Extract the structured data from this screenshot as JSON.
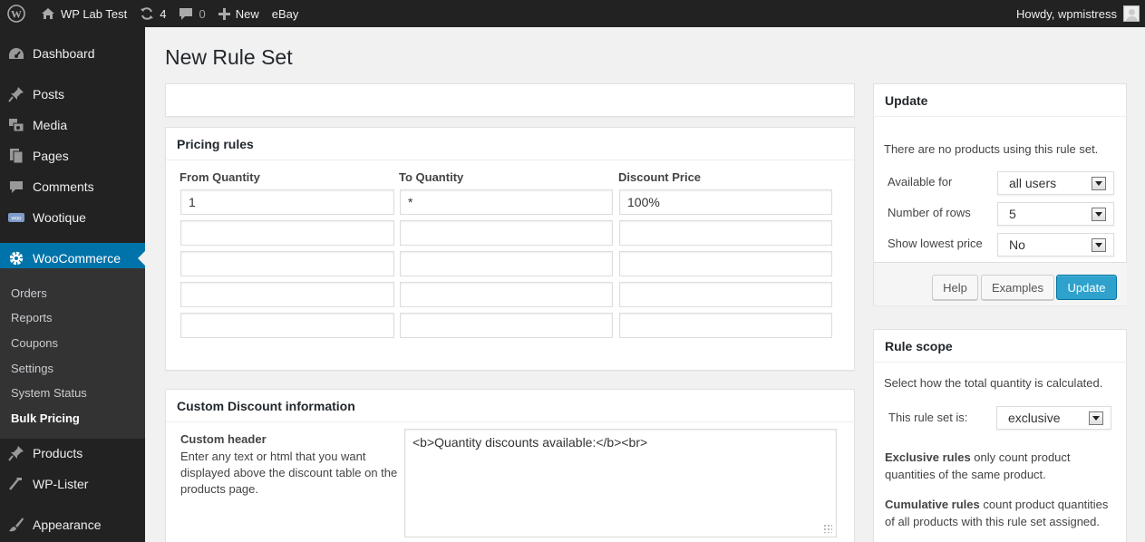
{
  "adminbar": {
    "site_name": "WP Lab Test",
    "updates_count": "4",
    "comments_count": "0",
    "new_label": "New",
    "ebay_label": "eBay",
    "howdy": "Howdy, wpmistress"
  },
  "sidebar": {
    "items": [
      {
        "label": "Dashboard",
        "icon": "dashboard-icon"
      },
      {
        "label": "Posts",
        "icon": "pin-icon"
      },
      {
        "label": "Media",
        "icon": "media-icon"
      },
      {
        "label": "Pages",
        "icon": "pages-icon"
      },
      {
        "label": "Comments",
        "icon": "comment-icon"
      },
      {
        "label": "Wootique",
        "icon": "woo-icon"
      },
      {
        "label": "WooCommerce",
        "icon": "gear-icon"
      },
      {
        "label": "Products",
        "icon": "pin-icon"
      },
      {
        "label": "WP-Lister",
        "icon": "hammer-icon"
      },
      {
        "label": "Appearance",
        "icon": "brush-icon"
      }
    ],
    "submenu": [
      "Orders",
      "Reports",
      "Coupons",
      "Settings",
      "System Status",
      "Bulk Pricing"
    ]
  },
  "page": {
    "title": "New Rule Set"
  },
  "pricing": {
    "title": "Pricing rules",
    "columns": [
      "From Quantity",
      "To Quantity",
      "Discount Price"
    ],
    "rows": [
      [
        "1",
        "*",
        "100%"
      ],
      [
        "",
        "",
        ""
      ],
      [
        "",
        "",
        ""
      ],
      [
        "",
        "",
        ""
      ],
      [
        "",
        "",
        ""
      ]
    ]
  },
  "custom": {
    "title": "Custom Discount information",
    "header_label": "Custom header",
    "header_desc": "Enter any text or html that you want displayed above the discount table on the products page.",
    "header_value": "<b>Quantity discounts available:</b><br>"
  },
  "update": {
    "title": "Update",
    "notice": "There are no products using this rule set.",
    "available_label": "Available for",
    "available_value": "all users",
    "rows_label": "Number of rows",
    "rows_value": "5",
    "lowest_label": "Show lowest price",
    "lowest_value": "No",
    "help_label": "Help",
    "examples_label": "Examples",
    "update_label": "Update"
  },
  "scope": {
    "title": "Rule scope",
    "intro": "Select how the total quantity is calculated.",
    "rule_label": "This rule set is:",
    "rule_value": "exclusive",
    "exclusive_bold": "Exclusive rules",
    "exclusive_text": " only count product quantities of the same product.",
    "cumulative_bold": "Cumulative rules",
    "cumulative_text": " count product quantities of all products with this rule set assigned."
  },
  "colors": {
    "adminbar": "#222222",
    "accent": "#0073aa",
    "primary_button": "#2ea2cc",
    "background": "#f1f1f1"
  }
}
